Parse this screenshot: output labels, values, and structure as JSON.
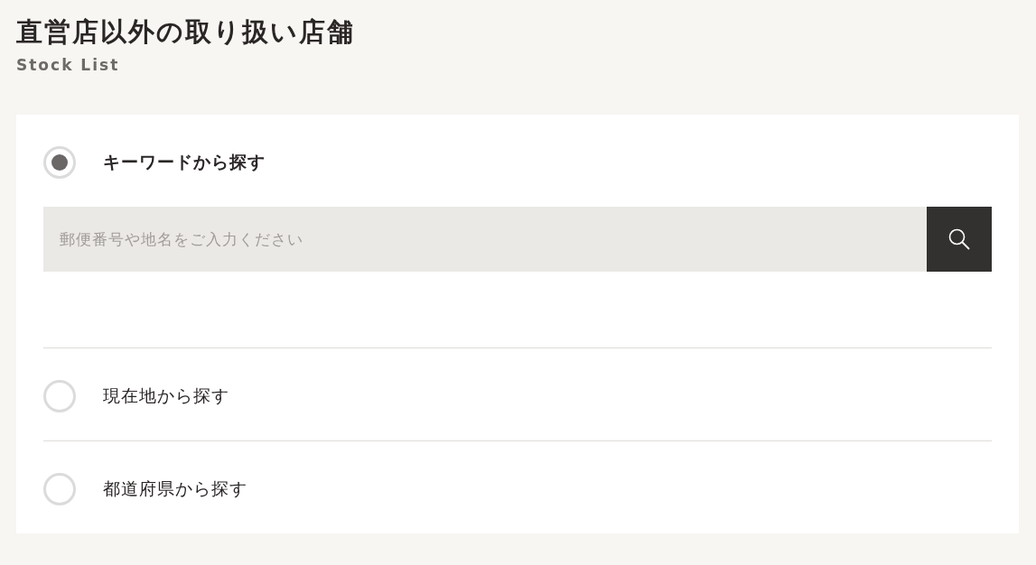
{
  "header": {
    "title": "直営店以外の取り扱い店舗",
    "subtitle": "Stock List"
  },
  "search": {
    "placeholder": "郵便番号や地名をご入力ください"
  },
  "options": [
    {
      "label": "キーワードから探す",
      "selected": true
    },
    {
      "label": "現在地から探す",
      "selected": false
    },
    {
      "label": "都道府県から探す",
      "selected": false
    }
  ]
}
